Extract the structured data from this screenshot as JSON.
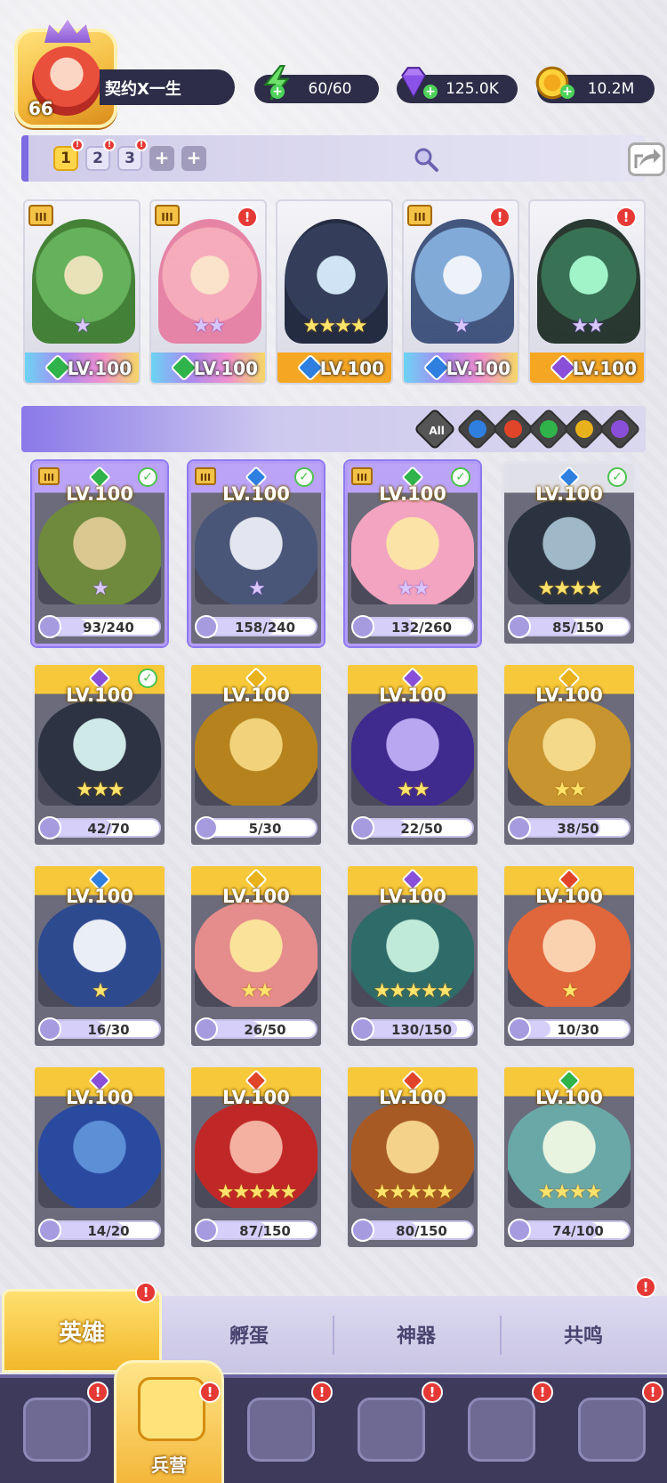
{
  "player": {
    "level": "66",
    "name": "契约X一生"
  },
  "resources": {
    "energy": "60/60",
    "gems": "125.0K",
    "gold": "10.2M"
  },
  "team": {
    "tabs": [
      "1",
      "2",
      "3"
    ],
    "active_tab": "1",
    "add_icons": [
      "+",
      "+"
    ]
  },
  "team_heroes": [
    {
      "level": "LV.100",
      "element": "nature",
      "tier": "III",
      "stars": 1,
      "alert": false
    },
    {
      "level": "LV.100",
      "element": "nature",
      "tier": "III",
      "stars": 2,
      "alert": true
    },
    {
      "level": "LV.100",
      "element": "water",
      "tier": "",
      "stars": 4,
      "alert": false
    },
    {
      "level": "LV.100",
      "element": "water",
      "tier": "III",
      "stars": 1,
      "alert": true
    },
    {
      "level": "LV.100",
      "element": "dark",
      "tier": "",
      "stars": 2,
      "alert": true
    }
  ],
  "filter": {
    "all_label": "All",
    "elements": [
      "water",
      "fire",
      "nature",
      "light",
      "dark"
    ]
  },
  "heroes": [
    {
      "level": "LV.100",
      "element": "nature",
      "shards": "93/240",
      "progress": 0.39,
      "stars": 1,
      "check": true,
      "tier": "III",
      "frame": "purple"
    },
    {
      "level": "LV.100",
      "element": "water",
      "shards": "158/240",
      "progress": 0.66,
      "stars": 1,
      "check": true,
      "tier": "III",
      "frame": "purple"
    },
    {
      "level": "LV.100",
      "element": "nature",
      "shards": "132/260",
      "progress": 0.51,
      "stars": 2,
      "check": true,
      "tier": "III",
      "frame": "purple"
    },
    {
      "level": "LV.100",
      "element": "water",
      "shards": "85/150",
      "progress": 0.57,
      "stars": 4,
      "check": true,
      "tier": "",
      "frame": "gold"
    },
    {
      "level": "LV.100",
      "element": "dark",
      "shards": "42/70",
      "progress": 0.6,
      "stars": 3,
      "check": true,
      "tier": "",
      "frame": "gold"
    },
    {
      "level": "LV.100",
      "element": "light",
      "shards": "5/30",
      "progress": 0.17,
      "stars": 0,
      "check": false,
      "tier": "",
      "frame": "gold"
    },
    {
      "level": "LV.100",
      "element": "dark",
      "shards": "22/50",
      "progress": 0.44,
      "stars": 2,
      "check": false,
      "tier": "",
      "frame": "gold"
    },
    {
      "level": "LV.100",
      "element": "light",
      "shards": "38/50",
      "progress": 0.76,
      "stars": 2,
      "check": false,
      "tier": "",
      "frame": "gold"
    },
    {
      "level": "LV.100",
      "element": "water",
      "shards": "16/30",
      "progress": 0.53,
      "stars": 1,
      "check": false,
      "tier": "",
      "frame": "gold"
    },
    {
      "level": "LV.100",
      "element": "light",
      "shards": "26/50",
      "progress": 0.52,
      "stars": 2,
      "check": false,
      "tier": "",
      "frame": "gold"
    },
    {
      "level": "LV.100",
      "element": "dark",
      "shards": "130/150",
      "progress": 0.87,
      "stars": 5,
      "check": false,
      "tier": "",
      "frame": "gold"
    },
    {
      "level": "LV.100",
      "element": "fire",
      "shards": "10/30",
      "progress": 0.33,
      "stars": 1,
      "check": false,
      "tier": "",
      "frame": "gold"
    },
    {
      "level": "LV.100",
      "element": "dark",
      "shards": "14/20",
      "progress": 0.7,
      "stars": 0,
      "check": false,
      "tier": "",
      "frame": "gold"
    },
    {
      "level": "LV.100",
      "element": "fire",
      "shards": "87/150",
      "progress": 0.58,
      "stars": 5,
      "check": false,
      "tier": "",
      "frame": "gold"
    },
    {
      "level": "LV.100",
      "element": "fire",
      "shards": "80/150",
      "progress": 0.53,
      "stars": 5,
      "check": false,
      "tier": "",
      "frame": "gold"
    },
    {
      "level": "LV.100",
      "element": "nature",
      "shards": "74/100",
      "progress": 0.74,
      "stars": 4,
      "check": false,
      "tier": "",
      "frame": "gold"
    }
  ],
  "sub_tabs": [
    "英雄",
    "孵蛋",
    "神器",
    "共鸣"
  ],
  "nav": {
    "active_label": "兵营"
  },
  "colors": {
    "water": "#2f7fe0",
    "fire": "#e0452a",
    "nature": "#2fb34a",
    "light": "#e8b21c",
    "dark": "#8a4fd8"
  }
}
